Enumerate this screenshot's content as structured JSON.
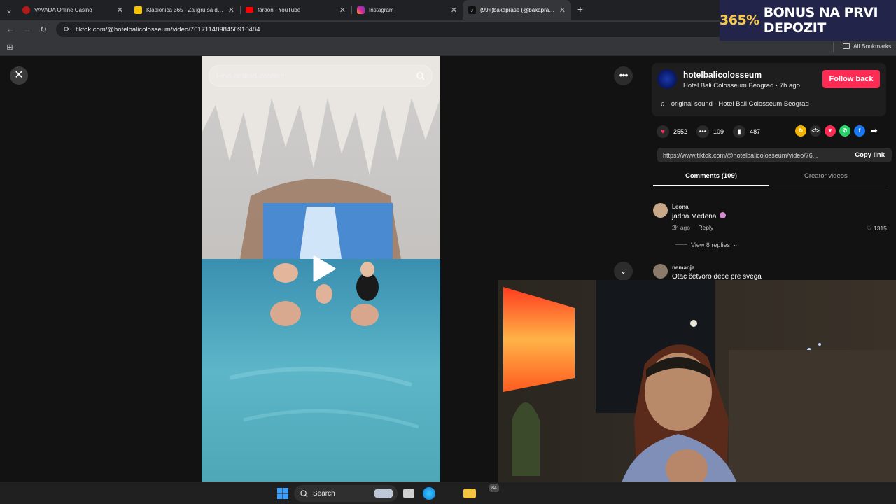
{
  "browser": {
    "tabs": [
      {
        "title": "VAVADA Online Casino",
        "favicon_color": "#b51a1a",
        "active": false
      },
      {
        "title": "Kladionica 365 - Za igru sa drug",
        "favicon_color": "#f5c400",
        "active": false
      },
      {
        "title": "faraon - YouTube",
        "favicon_color": "#ff0000",
        "active": false
      },
      {
        "title": "Instagram",
        "favicon_color": "#d6249f",
        "active": false
      },
      {
        "title": "(99+)bakaprase (@bakaprase) |",
        "favicon_color": "#111111",
        "active": true
      }
    ],
    "new_tab_label": "+",
    "url": "tiktok.com/@hotelbalicolosseum/video/7617114898450910484",
    "bookmarks_label": "All Bookmarks"
  },
  "promo_banner": {
    "percent": "365%",
    "text": "BONUS NA PRVI DEPOZIT",
    "color": "#f7c948"
  },
  "video": {
    "search_placeholder": "Find related content"
  },
  "post": {
    "username": "hotelbalicolosseum",
    "display_name": "Hotel Bali Colosseum Beograd",
    "time_ago": "7h ago",
    "follow_label": "Follow back",
    "sound": "original sound - Hotel Bali Colosseum Beograd",
    "likes": "2552",
    "comments": "109",
    "saves": "487",
    "share_url": "https://www.tiktok.com/@hotelbalicolosseum/video/76...",
    "copy_label": "Copy link"
  },
  "panel_tabs": {
    "comments": "Comments (109)",
    "creator": "Creator videos"
  },
  "comments": [
    {
      "name": "Leona",
      "text": "jadna Medena",
      "time": "2h ago",
      "reply": "Reply",
      "likes": "1315"
    },
    {
      "name": "nemanja",
      "text": "Otac četvoro dece pre svega"
    }
  ],
  "view_replies": "View 8 replies",
  "taskbar": {
    "search_label": "Search",
    "badge": "84"
  }
}
